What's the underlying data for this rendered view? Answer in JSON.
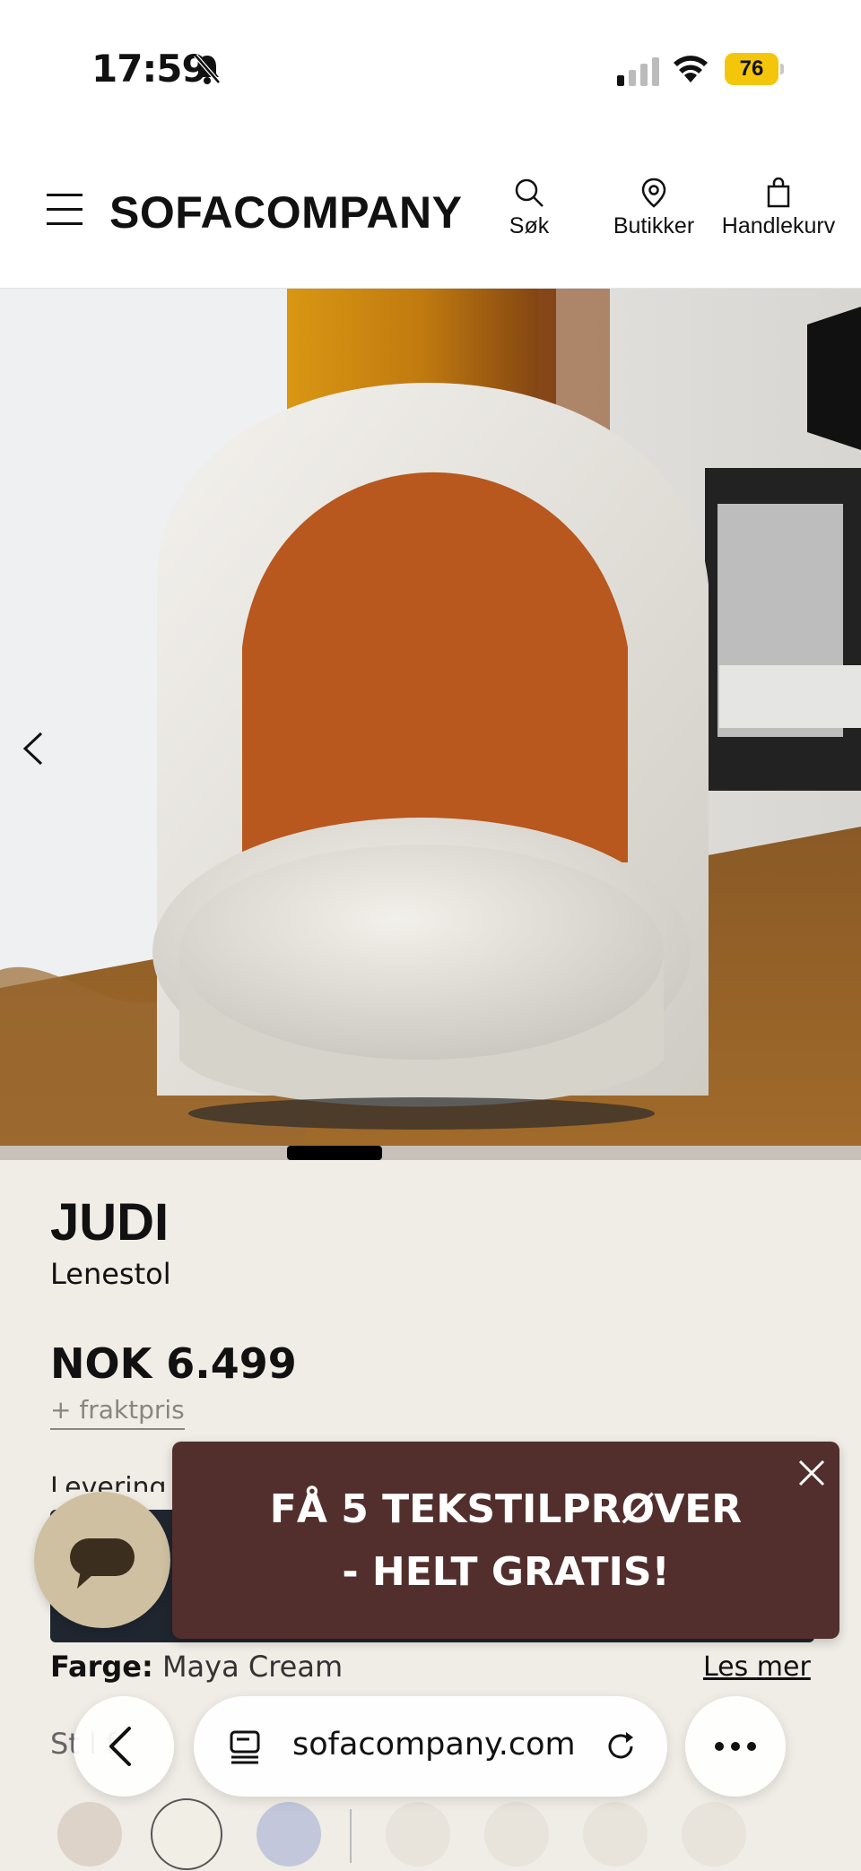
{
  "status_bar": {
    "time": "17:59",
    "battery": "76"
  },
  "header": {
    "brand": "SOFACOMPANY",
    "search_label": "Søk",
    "stores_label": "Butikker",
    "cart_label": "Handlekurv"
  },
  "product": {
    "name": "JUDI",
    "type": "Lenestol",
    "price": "NOK 6.499",
    "freight": "+ fraktpris",
    "delivery_partial": "Levering",
    "color_label": "Farge:",
    "color_value": "Maya Cream",
    "read_more": "Les mer",
    "fabric_partial": "St      l f"
  },
  "gallery": {
    "progress_fraction": 0.11
  },
  "promo": {
    "line1": "FÅ 5 TEKSTILPRØVER",
    "line2": "- HELT GRATIS!"
  },
  "browser": {
    "url": "sofacompany.com"
  },
  "colors": {
    "promo_bg": "#522f2c",
    "chat_bg": "#cfc0a1",
    "page_bg": "#f0ece6",
    "battery": "#f4c60b"
  }
}
